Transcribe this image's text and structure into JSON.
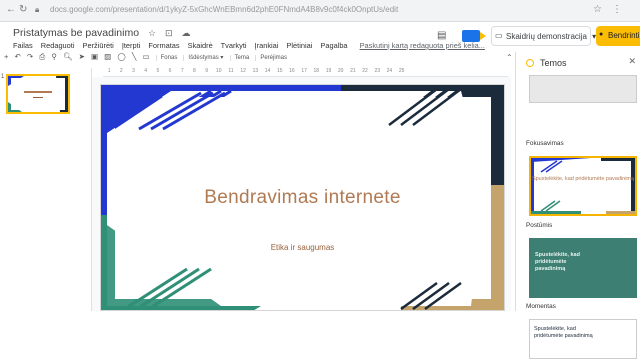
{
  "browser": {
    "url": "docs.google.com/presentation/d/1ykyZ-5xGhcWnEBmn6d2phE0FNmdA4B8v9c0f4ck0OnptUs/edit",
    "icons": [
      "back-icon",
      "reload-icon",
      "star-icon",
      "menu-icon"
    ]
  },
  "doc": {
    "title": "Pristatymas be pavadinimo",
    "title_icons": [
      "☆",
      "⊡",
      "☁"
    ]
  },
  "menu": {
    "items": [
      "Failas",
      "Redaguoti",
      "Peržiūrėti",
      "Įterpti",
      "Formatas",
      "Skaidrė",
      "Tvarkyti",
      "Įrankiai",
      "Plėtiniai",
      "Pagalba"
    ],
    "last_edit": "Paskutinį kartą redaguota prieš kelia..."
  },
  "header_actions": {
    "present_label": "Skaidrių demonstracija",
    "share_label": "Bendrinti"
  },
  "toolbar": {
    "fonas": "Fonas",
    "isdestymas": "Išdėstymas ▾",
    "tema": "Tema",
    "perejimas": "Perėjimas"
  },
  "ruler": {
    "ticks": [
      "1",
      "2",
      "3",
      "4",
      "5",
      "6",
      "7",
      "8",
      "9",
      "10",
      "11",
      "12",
      "13",
      "14",
      "15",
      "16",
      "17",
      "18",
      "19",
      "20",
      "21",
      "22",
      "23",
      "24",
      "25"
    ]
  },
  "filmstrip": {
    "slide_number": "1"
  },
  "slide": {
    "title": "Bendravimas internete",
    "subtitle": "Etika ir saugumas",
    "colors": {
      "title": "#b07a53",
      "blue": "#2338d1",
      "green": "#2f8f77",
      "navy": "#1c2b3c",
      "gold": "#c4a46b"
    }
  },
  "themes_panel": {
    "title": "Temos",
    "themes": [
      {
        "label": "Fokusavimas",
        "preview_text": "Spustelėkite, kad pridėtumėte pavadinimą"
      },
      {
        "label": "Postūmis",
        "preview_text": "Spustelėkite, kad pridėtumėte pavadinimą"
      },
      {
        "label": "Momentas",
        "preview_text": "Spustelėkite, kad pridėtumėte pavadinimą"
      }
    ]
  }
}
